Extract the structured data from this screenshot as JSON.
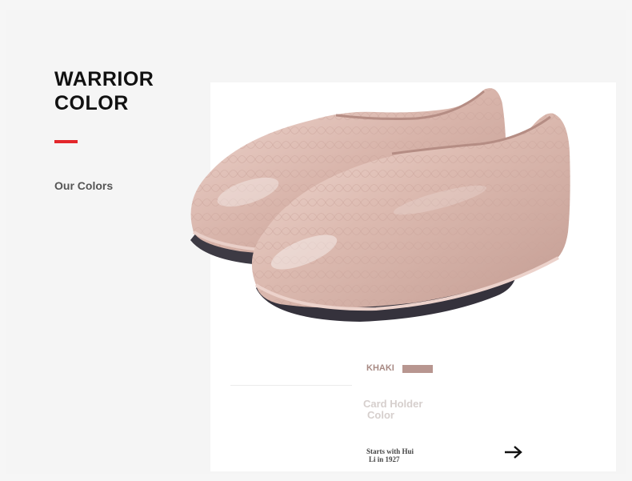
{
  "header": {
    "title_line1": "WARRIOR",
    "title_line2": "COLOR",
    "subtitle": "Our Colors",
    "accent_color": "#e3262b"
  },
  "product": {
    "image_icon": "khaki-rain-shoes-image",
    "color_name": "KHAKI",
    "swatch_color": "#b89690"
  },
  "card": {
    "heading_line1": "Card Holder",
    "heading_line2": "Color",
    "caption_line1": "Starts with Hui",
    "caption_line2": "Li in 1927",
    "arrow_icon": "arrow-right-icon"
  }
}
